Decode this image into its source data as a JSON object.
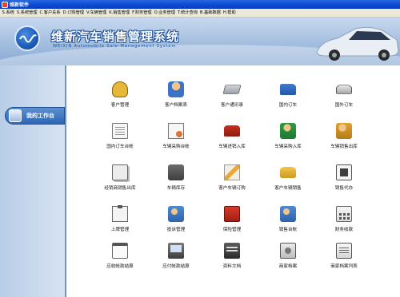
{
  "window": {
    "title": "维新软件"
  },
  "menu": [
    "S.系统",
    "S.系统管理",
    "C.客户关系",
    "D.订购管理",
    "V.车辆管理",
    "K.销售管理",
    "F.财务管理",
    "O.业务管理",
    "T.统计查询",
    "B.基础数据",
    "H.帮助"
  ],
  "banner": {
    "title_cn": "维新汽车销售管理系统",
    "title_en": "WEIXIN Automobile Sale Management System"
  },
  "sidebar": {
    "workbench_label": "我的工作台"
  },
  "functions": [
    {
      "label": "客户管理",
      "icon": "handshake-icon"
    },
    {
      "label": "客户档案表",
      "icon": "customer-file-icon"
    },
    {
      "label": "客户通讯录",
      "icon": "address-book-icon"
    },
    {
      "label": "国内订车",
      "icon": "truck-icon"
    },
    {
      "label": "国外订车",
      "icon": "car-icon"
    },
    {
      "label": "国内订车台帐",
      "icon": "ledger-icon"
    },
    {
      "label": "车辆采购台帐",
      "icon": "purchase-ledger-icon"
    },
    {
      "label": "车辆进销入库",
      "icon": "car-inbound-icon"
    },
    {
      "label": "车辆采购入库",
      "icon": "purchase-inbound-icon"
    },
    {
      "label": "车辆销售出库",
      "icon": "sales-outbound-icon"
    },
    {
      "label": "经销商销售出库",
      "icon": "dealer-outbound-icon"
    },
    {
      "label": "车辆库存",
      "icon": "inventory-icon"
    },
    {
      "label": "客户车辆订购",
      "icon": "order-pencil-icon"
    },
    {
      "label": "客户车辆销售",
      "icon": "sales-cart-icon"
    },
    {
      "label": "销售代办",
      "icon": "agency-card-icon"
    },
    {
      "label": "上牌管理",
      "icon": "license-clipboard-icon"
    },
    {
      "label": "投诉管理",
      "icon": "complaint-icon"
    },
    {
      "label": "保险管理",
      "icon": "insurance-book-icon"
    },
    {
      "label": "销售台帐",
      "icon": "sales-ledger-icon"
    },
    {
      "label": "财务收款",
      "icon": "calculator-icon"
    },
    {
      "label": "应收帐款结算",
      "icon": "receivable-calendar-icon"
    },
    {
      "label": "应付帐款结算",
      "icon": "payable-monitor-icon"
    },
    {
      "label": "资料文档",
      "icon": "documents-book-icon"
    },
    {
      "label": "商家档案",
      "icon": "merchant-folder-icon"
    },
    {
      "label": "商家档案列表",
      "icon": "merchant-list-icon"
    }
  ]
}
